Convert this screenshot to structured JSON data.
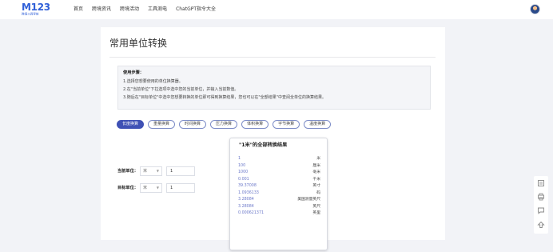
{
  "header": {
    "logo_text": "M123",
    "logo_subtitle": "跨境工具导航",
    "nav": [
      "首页",
      "跨境资讯",
      "跨境活动",
      "工具测电",
      "ChatGPT指令大全"
    ]
  },
  "page": {
    "title": "常用单位转换",
    "instructions": {
      "title": "使用步骤：",
      "steps": [
        "1.选择您想要使用的单位换算器。",
        "2.在\"当前单位\"下拉选项中选中您的当前单位，并输入当前数值。",
        "3.随后在\"目标单位\"中选中您想要转换的单位即可得到换算结果，您也可以在\"全部结果\"中查阅全单位的换算结果。"
      ]
    },
    "tabs": [
      "长度换算",
      "重量换算",
      "时间换算",
      "压力换算",
      "体积换算",
      "字节换算",
      "温度换算"
    ],
    "active_tab": "长度换算",
    "current_unit": {
      "label": "当前单位：",
      "unit": "米",
      "value": "1"
    },
    "target_unit": {
      "label": "目标单位：",
      "unit": "米",
      "value": "1"
    },
    "results": {
      "title": "\"1米\"的全部转换结果",
      "rows": [
        {
          "value": "1",
          "unit": "米"
        },
        {
          "value": "100",
          "unit": "厘米"
        },
        {
          "value": "1000",
          "unit": "毫米"
        },
        {
          "value": "0.001",
          "unit": "千米"
        },
        {
          "value": "39.37008",
          "unit": "英寸"
        },
        {
          "value": "1.0936133",
          "unit": "码"
        },
        {
          "value": "3.28084",
          "unit": "美国测量英尺"
        },
        {
          "value": "3.28084",
          "unit": "英尺"
        },
        {
          "value": "0.000621371",
          "unit": "英里"
        }
      ]
    }
  },
  "floating_tools": [
    "share-icon",
    "print-icon",
    "message-icon",
    "back-to-top-icon"
  ],
  "colors": {
    "accent": "#3f51b5",
    "logo": "#2f5fd8",
    "result_value": "#6b78c9",
    "background": "#f2f3f7"
  }
}
